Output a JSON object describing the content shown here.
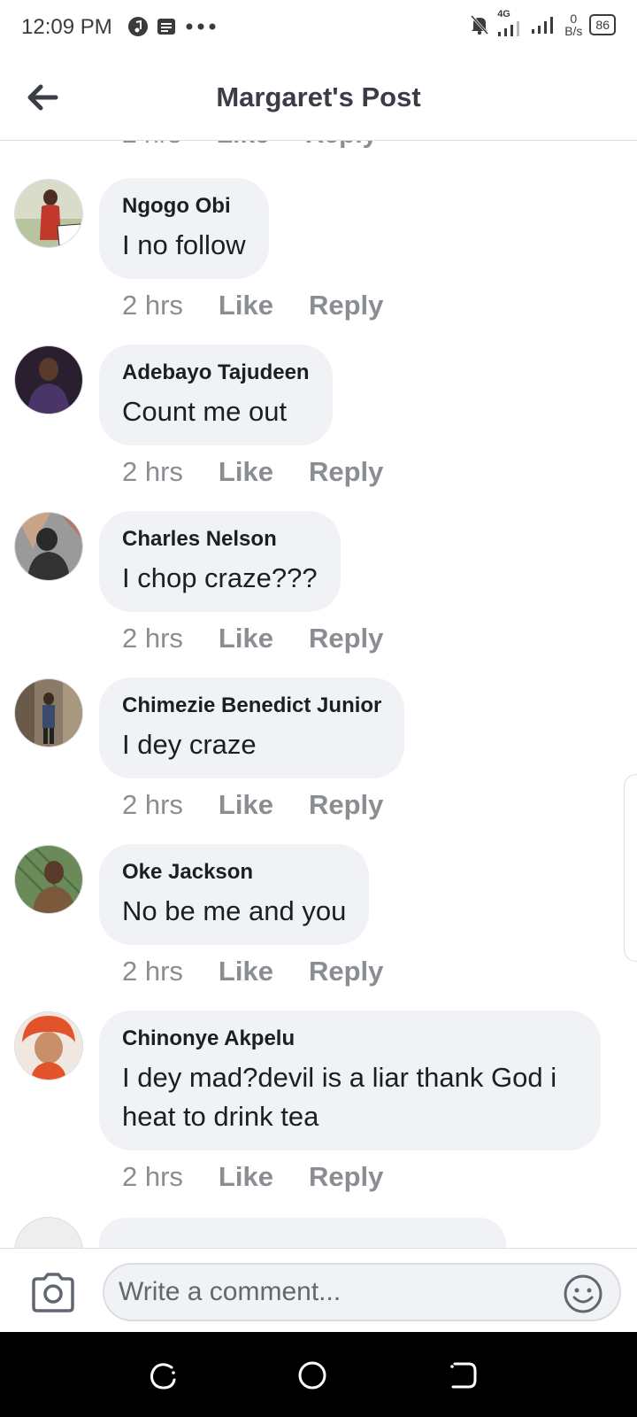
{
  "status_bar": {
    "time": "12:09 PM",
    "network": "4G",
    "speed_value": "0",
    "speed_unit": "B/s",
    "battery": "86"
  },
  "header": {
    "title": "Margaret's Post"
  },
  "partial_actions": {
    "time": "2 hrs",
    "like": "Like",
    "reply": "Reply"
  },
  "comments": [
    {
      "author": "Ngogo Obi",
      "text": "I no follow",
      "time": "2 hrs",
      "like": "Like",
      "reply": "Reply",
      "avatar_color": "#c0392b"
    },
    {
      "author": "Adebayo Tajudeen",
      "text": "Count me out",
      "time": "2 hrs",
      "like": "Like",
      "reply": "Reply",
      "avatar_color": "#3d2a4d"
    },
    {
      "author": "Charles Nelson",
      "text": "I chop craze???",
      "time": "2 hrs",
      "like": "Like",
      "reply": "Reply",
      "avatar_color": "#5a5a5a"
    },
    {
      "author": "Chimezie Benedict Junior",
      "text": "I dey craze",
      "time": "2 hrs",
      "like": "Like",
      "reply": "Reply",
      "avatar_color": "#7a6a58"
    },
    {
      "author": "Oke Jackson",
      "text": "No be me and you",
      "time": "2 hrs",
      "like": "Like",
      "reply": "Reply",
      "avatar_color": "#5d7a3a"
    },
    {
      "author": "Chinonye Akpelu",
      "text": "I dey mad?devil is a liar thank God i heat to drink tea",
      "time": "2 hrs",
      "like": "Like",
      "reply": "Reply",
      "avatar_color": "#e2532c"
    }
  ],
  "composer": {
    "placeholder": "Write a comment..."
  },
  "colors": {
    "bubble_bg": "#f0f2f5",
    "meta_text": "#8a8d91",
    "header_text": "#3a3d45"
  }
}
